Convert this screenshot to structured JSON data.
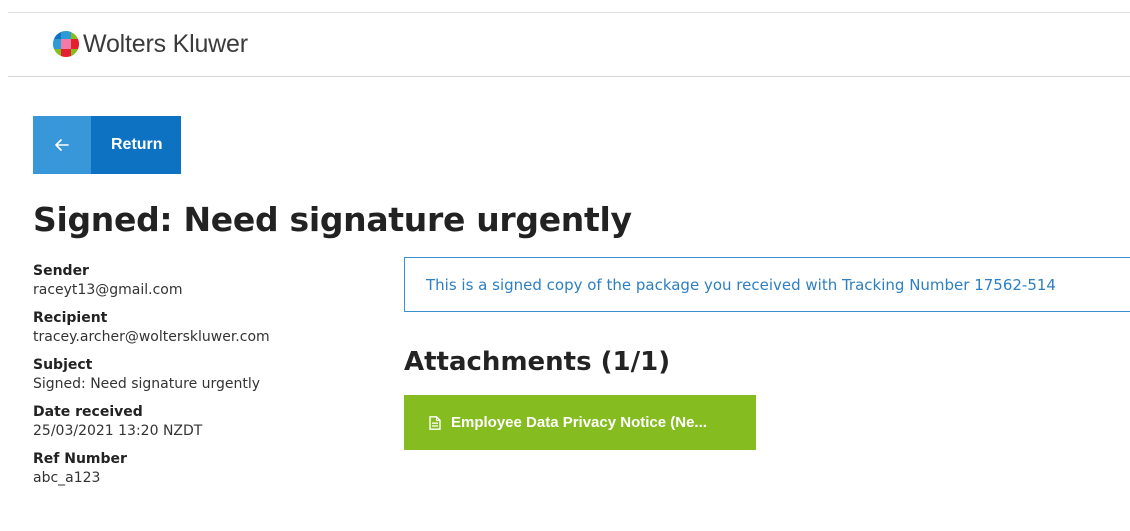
{
  "header": {
    "brand_name": "Wolters Kluwer",
    "logo_icon": "wolters-kluwer-globe-logo"
  },
  "nav": {
    "return_label": "Return",
    "return_icon": "left-arrow-icon"
  },
  "page": {
    "title": "Signed: Need signature urgently"
  },
  "details": {
    "sender_label": "Sender",
    "sender_value": "raceyt13@gmail.com",
    "recipient_label": "Recipient",
    "recipient_value": "tracey.archer@wolterskluwer.com",
    "subject_label": "Subject",
    "subject_value": "Signed: Need signature urgently",
    "date_label": "Date received",
    "date_value": "25/03/2021 13:20 NZDT",
    "ref_label": "Ref Number",
    "ref_value": "abc_a123"
  },
  "notice": {
    "text": "This is a signed copy of the package you received with Tracking Number 17562-514"
  },
  "attachments": {
    "heading": "Attachments (1/1)",
    "items": [
      {
        "label": "Employee Data Privacy Notice (Ne...",
        "icon": "document-icon"
      }
    ]
  },
  "colors": {
    "return_arrow_bg": "#3797d8",
    "return_label_bg": "#0e72c3",
    "notice_border": "#3b90cf",
    "notice_text": "#2d7fc3",
    "attachment_bg": "#85bc20"
  }
}
